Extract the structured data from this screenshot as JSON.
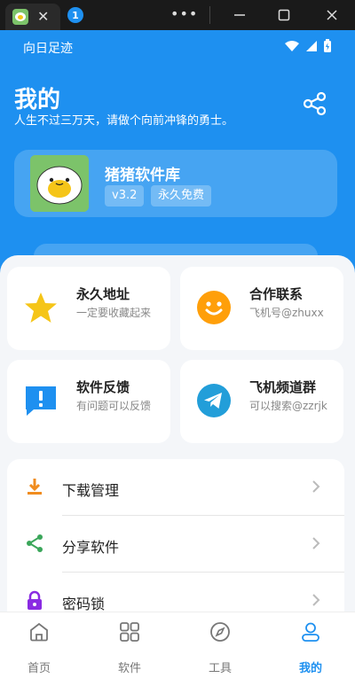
{
  "window": {
    "tab_close": "✕",
    "tab_badge": "1",
    "more": "•••"
  },
  "status": {
    "carrier_text": "向日足迹"
  },
  "header": {
    "title": "我的",
    "subtitle": "人生不过三万天，请做个向前冲锋的勇士。"
  },
  "app": {
    "name": "猪猪软件库",
    "version": "v3.2",
    "license": "永久免费"
  },
  "quick_cards": [
    {
      "title": "永久地址",
      "desc": "一定要收藏起来",
      "icon": "star-icon",
      "color": "#f5c518"
    },
    {
      "title": "合作联系",
      "desc": "飞机号@zhuxx",
      "icon": "smile-icon",
      "color": "#ff9f0a"
    },
    {
      "title": "软件反馈",
      "desc": "有问题可以反馈",
      "icon": "feedback-icon",
      "color": "#1e90f0"
    },
    {
      "title": "飞机频道群",
      "desc": "可以搜索@zzrjk",
      "icon": "telegram-icon",
      "color": "#229ed9"
    }
  ],
  "menu": [
    {
      "label": "下载管理",
      "icon": "download-icon",
      "color": "#f08c1e"
    },
    {
      "label": "分享软件",
      "icon": "share-icon",
      "color": "#3aa65a"
    },
    {
      "label": "密码锁",
      "icon": "lock-icon",
      "color": "#8a2be2"
    }
  ],
  "nav": [
    {
      "label": "首页",
      "icon": "home-icon"
    },
    {
      "label": "软件",
      "icon": "grid-icon"
    },
    {
      "label": "工具",
      "icon": "compass-icon"
    },
    {
      "label": "我的",
      "icon": "user-icon",
      "active": true
    }
  ],
  "colors": {
    "primary": "#1e90f0",
    "background": "#f4f6f9"
  }
}
